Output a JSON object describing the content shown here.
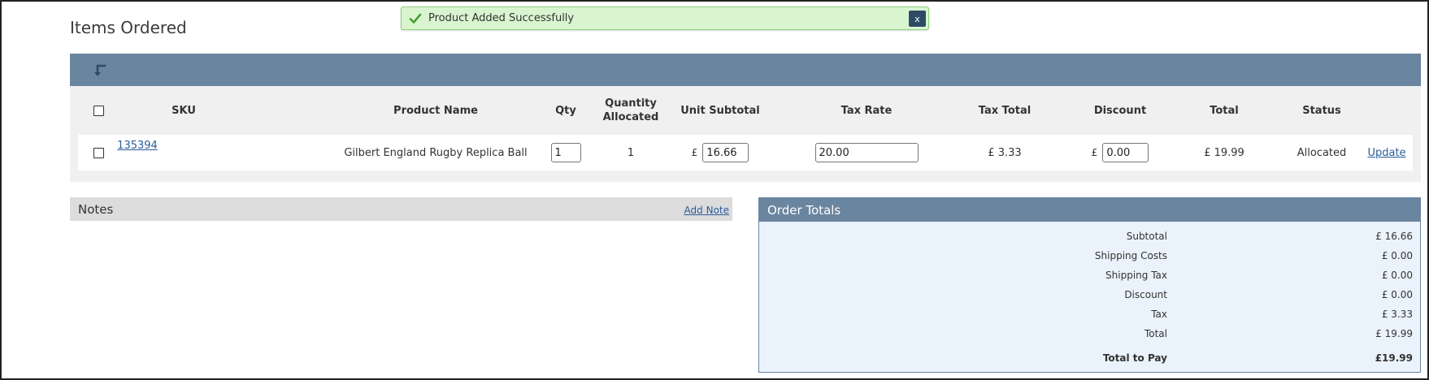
{
  "page": {
    "title": "Items Ordered"
  },
  "toast": {
    "message": "Product Added Successfully",
    "close_label": "x",
    "icon": "check-icon"
  },
  "items": {
    "back_icon": "corner-arrow-icon",
    "headers": {
      "sku": "SKU",
      "product_name": "Product Name",
      "qty": "Qty",
      "quantity_allocated_line1": "Quantity",
      "quantity_allocated_line2": "Allocated",
      "unit_subtotal": "Unit Subtotal",
      "tax_rate": "Tax Rate",
      "tax_total": "Tax Total",
      "discount": "Discount",
      "total": "Total",
      "status": "Status"
    },
    "rows": [
      {
        "sku": "135394",
        "product_name": "Gilbert England Rugby Replica Ball",
        "qty": "1",
        "quantity_allocated": "1",
        "currency": "£",
        "unit_subtotal": "16.66",
        "tax_rate": "20.00",
        "tax_total": "£ 3.33",
        "discount": "0.00",
        "total": "£ 19.99",
        "status": "Allocated",
        "action": "Update"
      }
    ]
  },
  "notes": {
    "title": "Notes",
    "add_label": "Add Note"
  },
  "order_totals": {
    "title": "Order Totals",
    "lines": [
      {
        "label": "Subtotal",
        "value": "£ 16.66"
      },
      {
        "label": "Shipping Costs",
        "value": "£ 0.00"
      },
      {
        "label": "Shipping Tax",
        "value": "£ 0.00"
      },
      {
        "label": "Discount",
        "value": "£ 0.00"
      },
      {
        "label": "Tax",
        "value": "£ 3.33"
      },
      {
        "label": "Total",
        "value": "£ 19.99"
      }
    ],
    "total_to_pay": {
      "label": "Total to Pay",
      "value": "£19.99"
    }
  },
  "colors": {
    "panel_header": "#6a85a0",
    "toast_bg": "#d9f5d0",
    "totals_bg": "#eaf2fb",
    "link": "#2a5d99"
  }
}
